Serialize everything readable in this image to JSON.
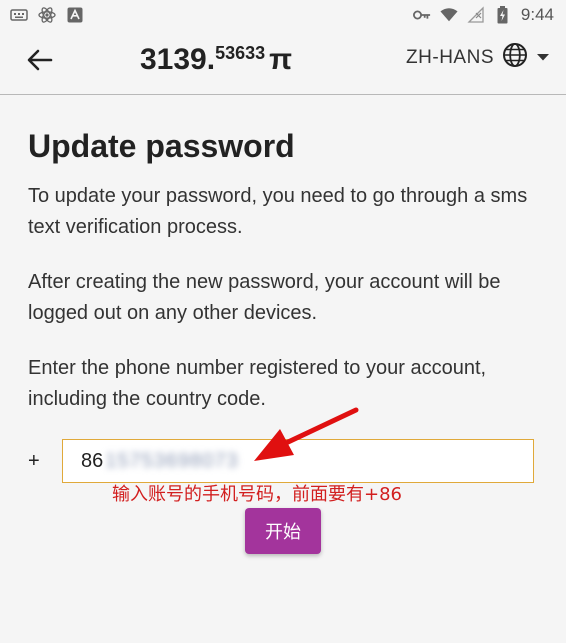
{
  "status_bar": {
    "left_icons": [
      "keyboard-icon",
      "react-atom-icon",
      "app-a-icon"
    ],
    "right_icons": [
      "key-icon",
      "wifi-icon",
      "no-signal-icon",
      "battery-charging-icon"
    ],
    "time": "9:44"
  },
  "app_bar": {
    "balance_integer": "3139.",
    "balance_decimal": "53633",
    "currency_symbol": "π",
    "language_label": "ZH-HANS"
  },
  "page": {
    "title": "Update password",
    "paragraph_1": "To update your password, you need to go through a sms text verification process.",
    "paragraph_2": "After creating the new password, your account will be logged out on any other devices.",
    "paragraph_3": "Enter the phone number registered to your account, including the country code."
  },
  "phone": {
    "prefix": "+",
    "country_code": "86",
    "masked_number": "15753698073"
  },
  "annotation": "输入账号的手机号码，前面要有+86",
  "start_button_label": "开始",
  "colors": {
    "accent_button": "#a3349c",
    "input_border": "#e0a93a",
    "annotation_red": "#d21f1f"
  }
}
